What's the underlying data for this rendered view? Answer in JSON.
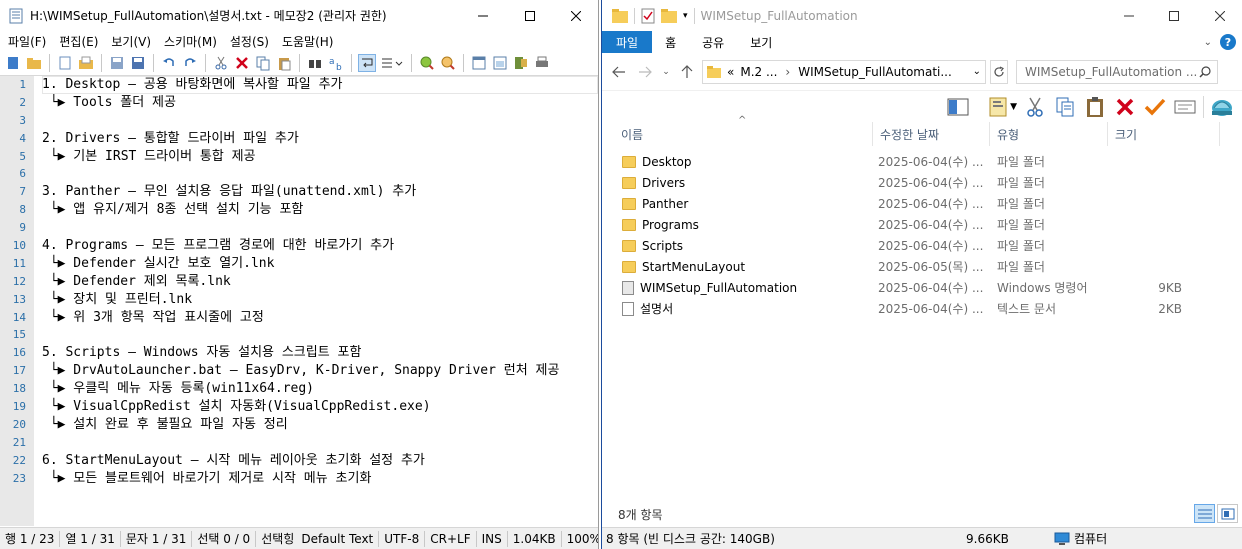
{
  "notepad": {
    "title": "H:\\WIMSetup_FullAutomation\\설명서.txt - 메모장2 (관리자 권한)",
    "menu": [
      "파일(F)",
      "편집(E)",
      "보기(V)",
      "스키마(M)",
      "설정(S)",
      "도움말(H)"
    ],
    "lines": [
      "1. Desktop – 공용 바탕화면에 복사할 파일 추가",
      " └▶ Tools 폴더 제공",
      "",
      "2. Drivers – 통합할 드라이버 파일 추가",
      " └▶ 기본 IRST 드라이버 통합 제공",
      "",
      "3. Panther – 무인 설치용 응답 파일(unattend.xml) 추가",
      " └▶ 앱 유지/제거 8종 선택 설치 기능 포함",
      "",
      "4. Programs – 모든 프로그램 경로에 대한 바로가기 추가",
      " └▶ Defender 실시간 보호 열기.lnk",
      " └▶ Defender 제외 목록.lnk",
      " └▶ 장치 및 프린터.lnk",
      " └▶ 위 3개 항목 작업 표시줄에 고정",
      "",
      "5. Scripts – Windows 자동 설치용 스크립트 포함",
      " └▶ DrvAutoLauncher.bat – EasyDrv, K-Driver, Snappy Driver 런처 제공",
      " └▶ 우클릭 메뉴 자동 등록(win11x64.reg)",
      " └▶ VisualCppRedist 설치 자동화(VisualCppRedist.exe)",
      " └▶ 설치 완료 후 불필요 파일 자동 정리",
      "",
      "6. StartMenuLayout – 시작 메뉴 레이아웃 초기화 설정 추가",
      " └▶ 모든 블로트웨어 바로가기 제거로 시작 메뉴 초기화"
    ],
    "line_numbers": [
      "1",
      "2",
      "3",
      "4",
      "5",
      "6",
      "7",
      "8",
      "9",
      "10",
      "11",
      "12",
      "13",
      "14",
      "15",
      "16",
      "17",
      "18",
      "19",
      "20",
      "21",
      "22",
      "23"
    ],
    "status": {
      "line": "행 1 / 23",
      "col": "열 1 / 31",
      "chars": "문자 1 / 31",
      "sel": "선택 0 / 0",
      "selected": "선택힝",
      "scheme": "Default Text",
      "encoding": "UTF-8",
      "eol": "CR+LF",
      "ins": "INS",
      "size": "1.04KB",
      "zoom": "100%"
    }
  },
  "explorer": {
    "title": "WIMSetup_FullAutomation",
    "ribbon_tabs": [
      "파일",
      "홈",
      "공유",
      "보기"
    ],
    "address": {
      "prefix": "«",
      "crumb1": "M.2 ...",
      "sep": "›",
      "crumb2": "WIMSetup_FullAutomati..."
    },
    "search_placeholder": "WIMSetup_FullAutomation ...",
    "columns": {
      "name": "이름",
      "date": "수정한 날짜",
      "type": "유형",
      "size": "크기"
    },
    "files": [
      {
        "name": "Desktop",
        "date": "2025-06-04(수) ...",
        "type": "파일 폴더",
        "size": "",
        "icon": "folder"
      },
      {
        "name": "Drivers",
        "date": "2025-06-04(수) ...",
        "type": "파일 폴더",
        "size": "",
        "icon": "folder"
      },
      {
        "name": "Panther",
        "date": "2025-06-04(수) ...",
        "type": "파일 폴더",
        "size": "",
        "icon": "folder"
      },
      {
        "name": "Programs",
        "date": "2025-06-04(수) ...",
        "type": "파일 폴더",
        "size": "",
        "icon": "folder"
      },
      {
        "name": "Scripts",
        "date": "2025-06-04(수) ...",
        "type": "파일 폴더",
        "size": "",
        "icon": "folder"
      },
      {
        "name": "StartMenuLayout",
        "date": "2025-06-05(목) ...",
        "type": "파일 폴더",
        "size": "",
        "icon": "folder"
      },
      {
        "name": "WIMSetup_FullAutomation",
        "date": "2025-06-04(수) ...",
        "type": "Windows 명령어 ...",
        "size": "9KB",
        "icon": "cmd"
      },
      {
        "name": "설명서",
        "date": "2025-06-04(수) ...",
        "type": "텍스트 문서",
        "size": "2KB",
        "icon": "text"
      }
    ],
    "item_count": "8개 항목",
    "status": {
      "items": "8 항목 (빈 디스크 공간: 140GB)",
      "size": "9.66KB",
      "computer": "컴퓨터"
    }
  },
  "colors": {
    "accent": "#1979ca",
    "folder": "#f6cd5a",
    "gutter_bg": "#e8e8e8",
    "line_number": "#2b6fa8",
    "delete_red": "#d0021b",
    "check_orange": "#e8750a"
  }
}
